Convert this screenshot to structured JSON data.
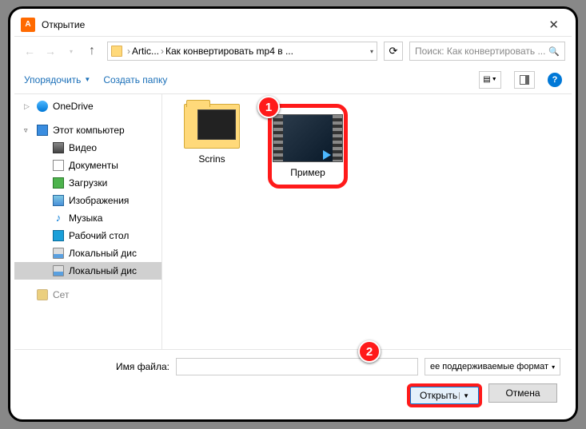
{
  "title": "Открытие",
  "nav": {
    "path1": "Artic...",
    "path2": "Как конвертировать mp4 в ...",
    "search_placeholder": "Поиск: Как конвертировать ..."
  },
  "toolbar": {
    "organize": "Упорядочить",
    "newfolder": "Создать папку"
  },
  "sidebar": {
    "onedrive": "OneDrive",
    "thispc": "Этот компьютер",
    "items": [
      "Видео",
      "Документы",
      "Загрузки",
      "Изображения",
      "Музыка",
      "Рабочий стол",
      "Локальный дис",
      "Локальный дис"
    ],
    "network_partial": "Сет"
  },
  "files": {
    "folder": "Scrins",
    "video": "Пример"
  },
  "bottom": {
    "filename_label": "Имя файла:",
    "filename_value": "",
    "filter": "ее поддерживаемые формат",
    "open": "Открыть",
    "cancel": "Отмена"
  },
  "markers": {
    "one": "1",
    "two": "2"
  }
}
